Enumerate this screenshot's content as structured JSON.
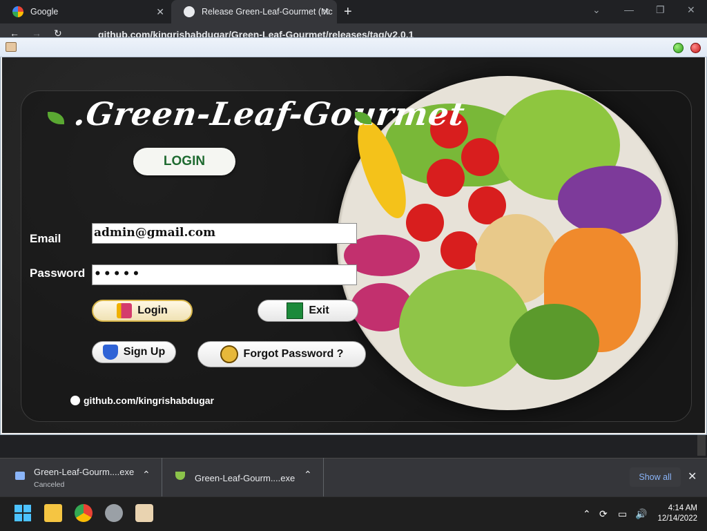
{
  "browser": {
    "tabs": [
      {
        "title": "Google"
      },
      {
        "title": "Release Green-Leaf-Gourmet (Mc"
      }
    ],
    "new_tab_label": "+",
    "address": "github.com/kingrishabdugar/Green-Leaf-Gourmet/releases/tag/v2.0.1"
  },
  "app": {
    "title": ".Green-Leaf-Gourmet",
    "login_heading": "LOGIN",
    "email_label": "Email",
    "email_value": "admin@gmail.com",
    "password_label": "Password",
    "password_value": "•••••",
    "buttons": {
      "login": "Login",
      "exit": "Exit",
      "signup": "Sign Up",
      "forgot": "Forgot Password ?"
    },
    "footer_link": "github.com/kingrishabdugar"
  },
  "downloads": {
    "items": [
      {
        "name": "Green-Leaf-Gourm....exe",
        "status": "Canceled"
      },
      {
        "name": "Green-Leaf-Gourm....exe",
        "status": ""
      }
    ],
    "show_all": "Show all"
  },
  "taskbar": {
    "time": "4:14 AM",
    "date": "12/14/2022"
  },
  "colors": {
    "accent_green": "#1f6b31",
    "leaf_green": "#5aa832",
    "chrome_link_blue": "#8ab4f8"
  },
  "icons": [
    "google-icon",
    "github-icon",
    "close-icon",
    "plus-icon",
    "exit-icon",
    "shield-icon",
    "key-icon",
    "login-icon",
    "java-icon",
    "windows-start-icon",
    "folder-icon",
    "chrome-icon",
    "gear-icon"
  ]
}
